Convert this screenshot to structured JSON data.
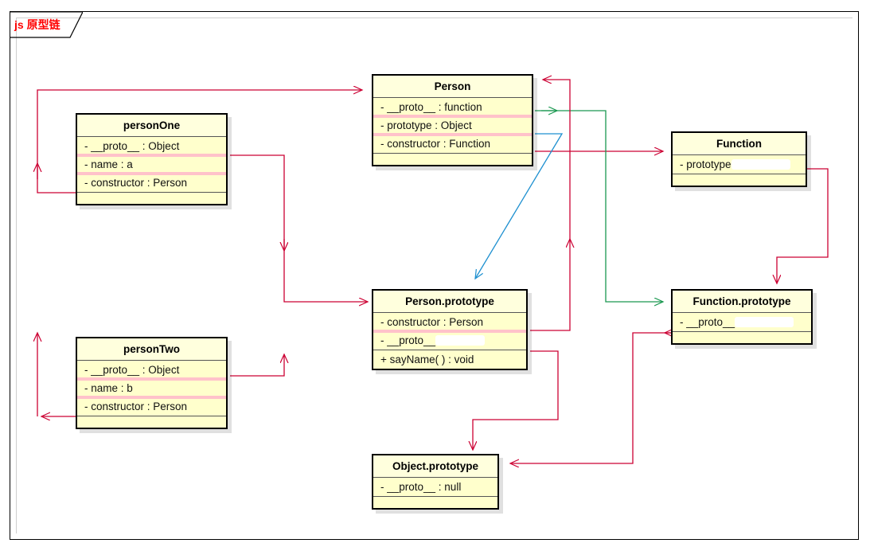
{
  "frame": {
    "title": "js 原型链",
    "title_color": "#ff0000"
  },
  "colors": {
    "box_fill": "#ffffcc",
    "box_border": "#000000",
    "highlight": "#ffaec9",
    "link_red": "#cc0033",
    "link_green": "#1a9850",
    "link_blue": "#1e90d0"
  },
  "classes": {
    "person": {
      "name": "Person",
      "attributes": [
        {
          "text": "-  __proto__  : function",
          "highlight": false
        },
        {
          "text": "-  prototype : Object",
          "highlight": true
        },
        {
          "text": "-  constructor : Function",
          "highlight": true
        }
      ]
    },
    "person_one": {
      "name": "personOne",
      "attributes": [
        {
          "text": "-  __proto__  : Object",
          "highlight": false
        },
        {
          "text": "-  name : a",
          "highlight": true
        },
        {
          "text": "-  constructor : Person",
          "highlight": true
        }
      ]
    },
    "person_two": {
      "name": "personTwo",
      "attributes": [
        {
          "text": "-  __proto__  : Object",
          "highlight": false
        },
        {
          "text": "-  name : b",
          "highlight": true
        },
        {
          "text": "-  constructor : Person",
          "highlight": true
        }
      ]
    },
    "person_prototype": {
      "name": "Person.prototype",
      "attributes": [
        {
          "text": "-  constructor : Person",
          "highlight": false
        },
        {
          "text": "-  __proto__",
          "highlight": true,
          "redacted": true
        }
      ],
      "operations": [
        {
          "text": "+  sayName( ) : void"
        }
      ]
    },
    "function_class": {
      "name": "Function",
      "attributes": [
        {
          "text": "-  prototype",
          "highlight": false,
          "redacted": true
        }
      ]
    },
    "function_prototype": {
      "name": "Function.prototype",
      "attributes": [
        {
          "text": "-  __proto__",
          "highlight": false,
          "redacted": true
        }
      ]
    },
    "object_prototype": {
      "name": "Object.prototype",
      "attributes": [
        {
          "text": "-  __proto__  : null",
          "highlight": false
        }
      ]
    }
  },
  "links": [
    {
      "name": "person-one-proto-to-person",
      "color": "#cc0033",
      "from": "personOne.__proto__",
      "to": "Person"
    },
    {
      "name": "person-one-constructor-to-person",
      "color": "#cc0033",
      "from": "personOne.constructor",
      "to": "Person"
    },
    {
      "name": "person-two-constructor-to-person",
      "color": "#cc0033",
      "from": "personTwo.constructor",
      "to": "Person"
    },
    {
      "name": "person-one-proto-to-person-prototype",
      "color": "#cc0033",
      "from": "personOne.__proto__",
      "to": "Person.prototype"
    },
    {
      "name": "person-two-proto-to-person-prototype",
      "color": "#cc0033",
      "from": "personTwo.__proto__",
      "to": "Person.prototype"
    },
    {
      "name": "person-constructor-to-function",
      "color": "#cc0033",
      "from": "Person.constructor",
      "to": "Function"
    },
    {
      "name": "person-proto-to-function-prototype",
      "color": "#1a9850",
      "from": "Person.__proto__",
      "to": "Function.prototype"
    },
    {
      "name": "person-prototype-link-to-person-prototype",
      "color": "#1e90d0",
      "from": "Person.prototype",
      "to": "Person.prototype box"
    },
    {
      "name": "person-prototype-constructor-to-person",
      "color": "#cc0033",
      "from": "Person.prototype.constructor",
      "to": "Person"
    },
    {
      "name": "person-prototype-proto-to-object-prototype",
      "color": "#cc0033",
      "from": "Person.prototype.__proto__",
      "to": "Object.prototype"
    },
    {
      "name": "function-prototype-to-function-prototype-box",
      "color": "#cc0033",
      "from": "Function.prototype attr",
      "to": "Function.prototype"
    },
    {
      "name": "function-prototype-proto-to-object-prototype",
      "color": "#cc0033",
      "from": "Function.prototype.__proto__",
      "to": "Object.prototype"
    }
  ]
}
